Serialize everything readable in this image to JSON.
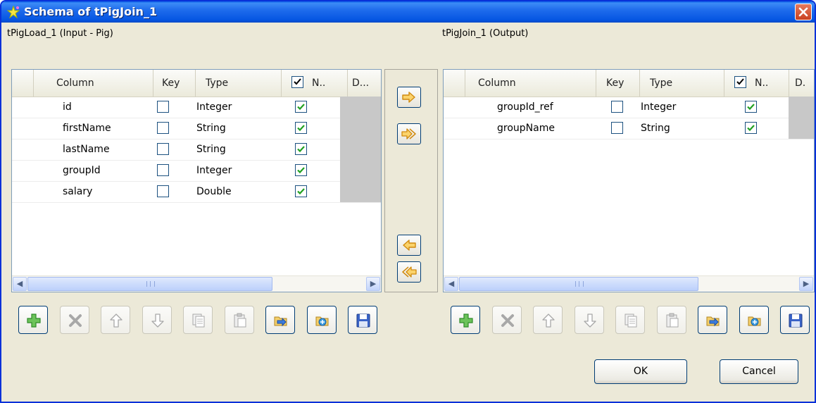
{
  "window": {
    "title": "Schema of tPigJoin_1"
  },
  "input": {
    "label": "tPigLoad_1 (Input - Pig)",
    "columns": {
      "column": "Column",
      "key": "Key",
      "type": "Type",
      "nullable": "N..",
      "default": "D..."
    },
    "rows": [
      {
        "column": "id",
        "type": "Integer",
        "key": false,
        "nullable": true
      },
      {
        "column": "firstName",
        "type": "String",
        "key": false,
        "nullable": true
      },
      {
        "column": "lastName",
        "type": "String",
        "key": false,
        "nullable": true
      },
      {
        "column": "groupId",
        "type": "Integer",
        "key": false,
        "nullable": true
      },
      {
        "column": "salary",
        "type": "Double",
        "key": false,
        "nullable": true
      }
    ]
  },
  "output": {
    "label": "tPigJoin_1 (Output)",
    "columns": {
      "column": "Column",
      "key": "Key",
      "type": "Type",
      "nullable": "N..",
      "default": "D."
    },
    "rows": [
      {
        "column": "groupId_ref",
        "type": "Integer",
        "key": false,
        "nullable": true
      },
      {
        "column": "groupName",
        "type": "String",
        "key": false,
        "nullable": true
      }
    ]
  },
  "transfer_buttons": [
    "copy-selected-right-icon",
    "copy-all-right-icon",
    "copy-selected-left-icon",
    "copy-all-left-icon"
  ],
  "toolbar_icons": [
    "add-icon",
    "delete-icon",
    "move-up-icon",
    "move-down-icon",
    "copy-icon",
    "paste-icon",
    "import-icon",
    "export-icon",
    "save-icon"
  ],
  "buttons": {
    "ok": "OK",
    "cancel": "Cancel"
  },
  "colors": {
    "titlebar": "#0555e2",
    "dialog_bg": "#ece9d8",
    "check_green": "#21a121",
    "arrow_orange": "#f0a030",
    "scroll_blue": "#c1d3fb"
  }
}
